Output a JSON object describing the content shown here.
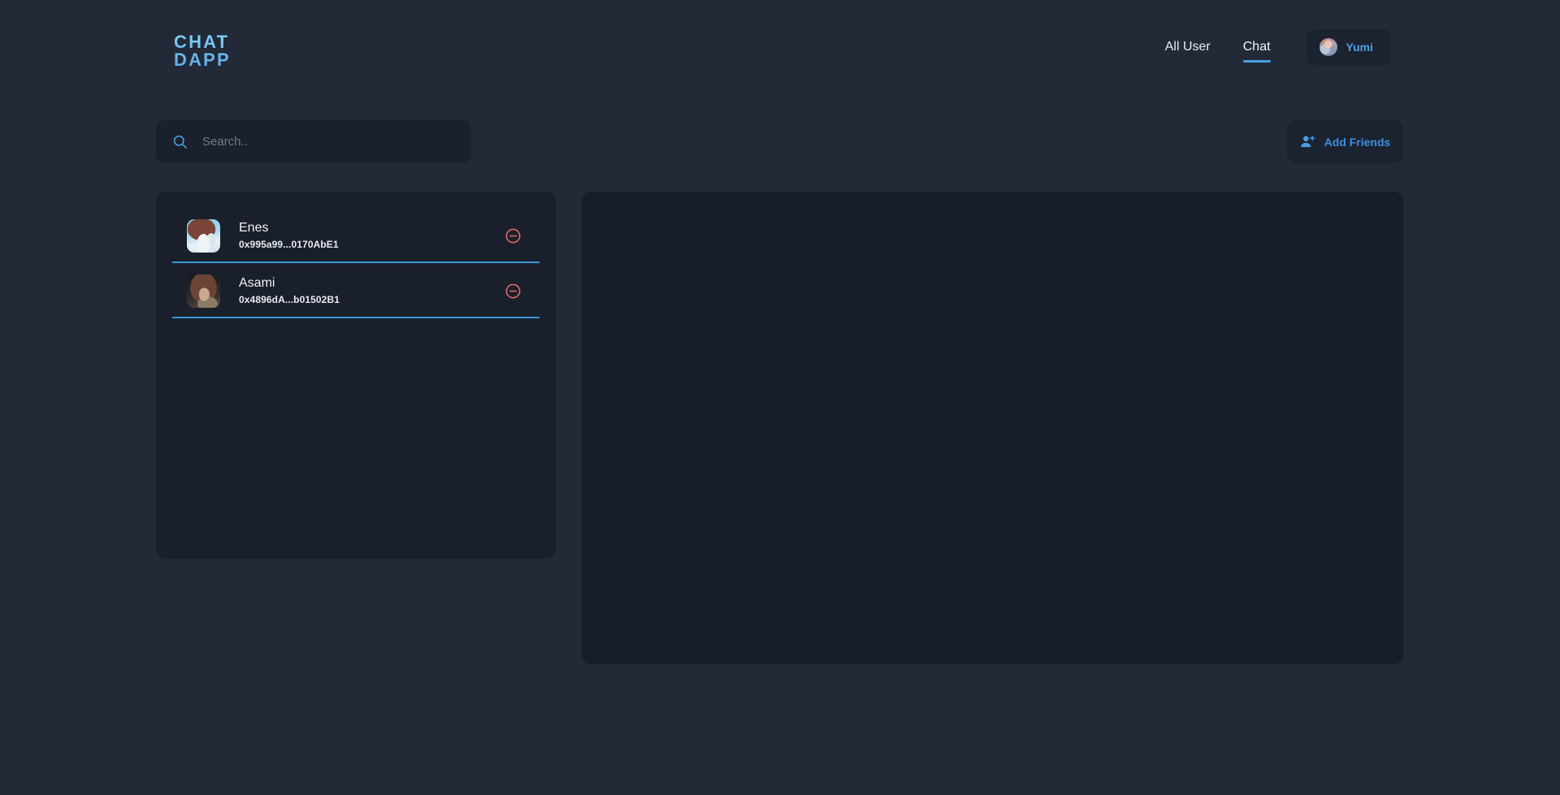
{
  "header": {
    "logo_line1": "CHAT",
    "logo_line2": "DAPP",
    "nav": [
      {
        "label": "All User",
        "active": false
      },
      {
        "label": "Chat",
        "active": true
      }
    ],
    "profile": {
      "name": "Yumi",
      "avatar_icon": "user-avatar-icon"
    }
  },
  "toolbar": {
    "search_placeholder": "Search..",
    "search_value": "",
    "search_icon": "search-icon",
    "add_friends_label": "Add Friends",
    "add_friends_icon": "user-plus-icon"
  },
  "friends": [
    {
      "name": "Enes",
      "address": "0x995a99...0170AbE1",
      "avatar_icon": "friend-avatar-icon",
      "remove_icon": "minus-circle-icon"
    },
    {
      "name": "Asami",
      "address": "0x4896dA...b01502B1",
      "avatar_icon": "friend-avatar-icon",
      "remove_icon": "minus-circle-icon"
    }
  ],
  "chat_panel": {
    "content": ""
  },
  "colors": {
    "page_bg": "#222a38",
    "card_bg": "#19202b",
    "panel_bg": "#171e29",
    "accent_blue": "#3d8fdd",
    "separator_blue": "#3a96d8",
    "remove_red": "#e86a6a",
    "logo_blue": "#7fd4f7"
  }
}
